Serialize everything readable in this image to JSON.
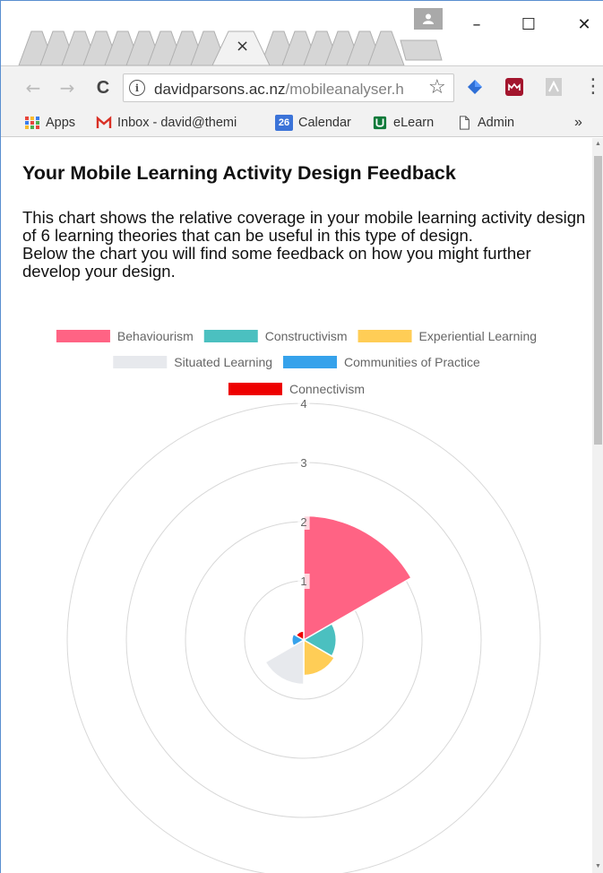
{
  "browser": {
    "tab_close_glyph": "×",
    "window_controls": {
      "minimize": "–",
      "maximize": "☐",
      "close": "✕"
    },
    "nav": {
      "back": "←",
      "forward": "→",
      "reload": "C"
    },
    "omnibox": {
      "info_glyph": "i",
      "url_host": "davidparsons.ac.nz",
      "url_path": "/mobileanalyser.h",
      "star_glyph": "☆"
    },
    "menu_glyph": "⋮",
    "bookmarks": [
      {
        "label": "Apps",
        "icon": "apps-grid-icon"
      },
      {
        "label": "Inbox - david@themi",
        "icon": "gmail-icon"
      },
      {
        "label": "Calendar",
        "icon": "calendar-icon",
        "badge": "26"
      },
      {
        "label": "eLearn",
        "icon": "elearn-icon"
      },
      {
        "label": "Admin",
        "icon": "page-icon"
      }
    ],
    "bookmarks_overflow": "»"
  },
  "page": {
    "title": "Your Mobile Learning Activity Design Feedback",
    "intro": "This chart shows the relative coverage in your mobile learning activity design of 6 learning theories that can be useful in this type of design.",
    "intro2": "Below the chart you will find some feedback on how you might further develop your design."
  },
  "chart_data": {
    "type": "polarArea",
    "series": [
      {
        "name": "Behaviourism",
        "value": 2.1,
        "color": "#ff6384"
      },
      {
        "name": "Constructivism",
        "value": 0.55,
        "color": "#4bc0c0"
      },
      {
        "name": "Experiential Learning",
        "value": 0.6,
        "color": "#ffcd56"
      },
      {
        "name": "Situated Learning",
        "value": 0.75,
        "color": "#e7e9ed"
      },
      {
        "name": "Communities of Practice",
        "value": 0.2,
        "color": "#36a2eb"
      },
      {
        "name": "Connectivism",
        "value": 0.15,
        "color": "#ee0000"
      }
    ],
    "rticks": [
      1,
      2,
      3,
      4
    ],
    "rlim": [
      0,
      4
    ],
    "legend_position": "top"
  }
}
